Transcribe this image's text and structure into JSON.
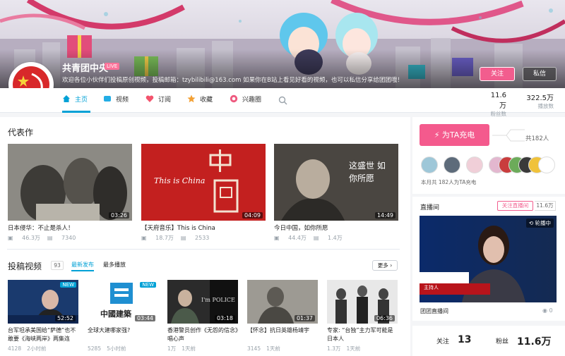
{
  "header": {
    "username": "共青团中央",
    "live_badge": "LIVE",
    "signature": "欢迎各位小伙伴们投稿原创视频，投稿邮箱：tzybilibili@163.com 如果你在B站上看见好看的视频，也可以私信分享给团团哦！",
    "follow_label": "关注",
    "message_label": "私信"
  },
  "nav": {
    "items": [
      {
        "label": "主页",
        "icon": "home-icon"
      },
      {
        "label": "视频",
        "icon": "video-icon"
      },
      {
        "label": "订阅",
        "icon": "heart-icon"
      },
      {
        "label": "收藏",
        "icon": "star-icon"
      },
      {
        "label": "兴趣圈",
        "icon": "circle-icon"
      }
    ],
    "stats": [
      {
        "value": "11.6万",
        "label": "粉丝数"
      },
      {
        "value": "322.5万",
        "label": "播放数"
      }
    ]
  },
  "masterpieces": {
    "title": "代表作",
    "items": [
      {
        "title": "日本侵华：不止是杀人！",
        "duration": "03:26",
        "plays": "46.3万",
        "danmaku": "7340"
      },
      {
        "title": "【天府音乐】This is China",
        "duration": "04:09",
        "plays": "18.7万",
        "danmaku": "2533",
        "thumb_text": "This is China"
      },
      {
        "title": "今日中国，如你所愿",
        "duration": "14:49",
        "plays": "44.4万",
        "danmaku": "1.4万",
        "thumb_text": "这盛世 如你所愿"
      }
    ]
  },
  "uploads": {
    "title": "投稿视频",
    "count": "93",
    "sort_latest": "最新发布",
    "sort_most": "最多播放",
    "more_label": "更多",
    "items": [
      {
        "title": "台军坦承美国给“萨德”也不敢要《海峡两岸》两集连",
        "duration": "52:52",
        "new": "NEW",
        "plays": "4128",
        "time": "2小时前"
      },
      {
        "title": "全球大建哪家强?",
        "duration": "03:44",
        "new": "NEW",
        "plays": "5285",
        "time": "5小时前",
        "thumb_text": "中國建築"
      },
      {
        "title": "香港警员创作《无怨的信念》唱心声",
        "duration": "03:18",
        "plays": "1万",
        "time": "1天前",
        "thumb_text": "I'm POLICE"
      },
      {
        "title": "【怀念】抗日英雄杨靖宇",
        "duration": "01:37",
        "plays": "3145",
        "time": "1天前"
      },
      {
        "title": "专家: “台独”主力军可能是日本人",
        "duration": "06:36",
        "plays": "1.3万",
        "time": "1天前"
      }
    ]
  },
  "charge": {
    "button_label": "为TA充电",
    "total": "共182人",
    "month_text": "本月共 182人为TA充电"
  },
  "live": {
    "title": "直播间",
    "follow_label": "关注直播间",
    "fans": "11.6万",
    "carousel_label": "轮播中",
    "room_name": "团团直播间",
    "online": "0",
    "host_label": "主持人"
  },
  "follow_stats": {
    "following_label": "关注",
    "following": "13",
    "fans_label": "粉丝",
    "fans": "11.6万"
  },
  "colors": {
    "accent_blue": "#00a1d6",
    "accent_pink": "#f25d8e"
  }
}
